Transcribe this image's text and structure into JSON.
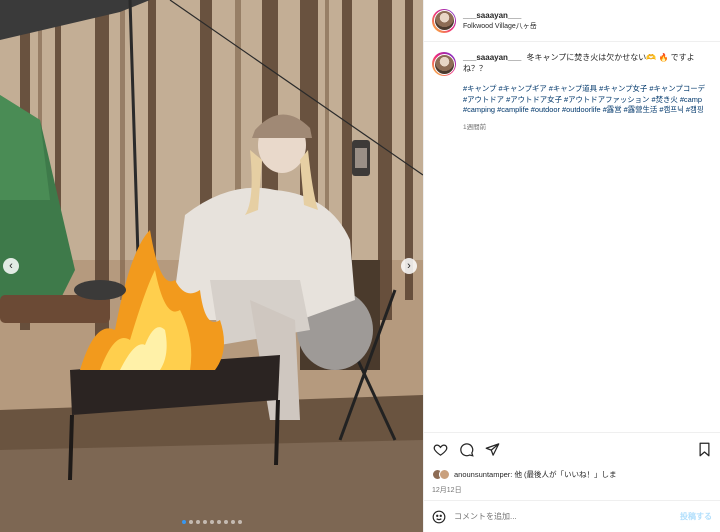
{
  "header": {
    "username": "___saaayan___",
    "location": "Folkwood Village八ヶ岳"
  },
  "caption": {
    "username": "___saaayan___",
    "text": "冬キャンプに焚き火は欠かせない🫶 🔥 ですよね？？",
    "hashtags": "#キャンプ #キャンプギア #キャンプ道具 #キャンプ女子 #キャンプコーデ #アウトドア #アウトドア女子 #アウトドアファッション #焚き火 #camp #camping #camplife #outdoor #outdoorlife #露営 #露營生活 #캠프닉 #캠핑",
    "time_ago": "1週間前"
  },
  "actions": {
    "like_icon": "heart-icon",
    "comment_icon": "comment-icon",
    "share_icon": "share-icon",
    "save_icon": "bookmark-icon"
  },
  "likes": {
    "text": "anounsuntamper: 他 (最後人が「いいね！」しま"
  },
  "date": "12月12日",
  "comment": {
    "placeholder": "コメントを追加...",
    "post_label": "投稿する"
  },
  "carousel": {
    "slide_count": 9,
    "active_index": 0,
    "prev_label": "‹",
    "next_label": "›"
  }
}
